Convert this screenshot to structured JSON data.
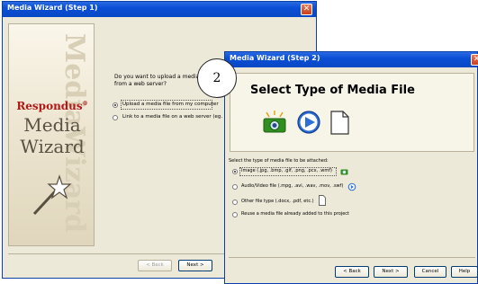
{
  "step1": {
    "title": "Media Wizard (Step 1)",
    "sidebar": {
      "watermark": "MediaWizard",
      "brand": "Respondus",
      "brand_mark": "®",
      "line1": "Media",
      "line2": "Wizard"
    },
    "question": "Do you want to upload a media file from a web server?",
    "options": [
      {
        "label": "Upload a media file from my computer",
        "selected": true
      },
      {
        "label": "Link to a media file on a web server (eg. Yo",
        "selected": false
      }
    ],
    "buttons": {
      "back": "< Back",
      "next": "Next >"
    }
  },
  "step2": {
    "title": "Media Wizard (Step 2)",
    "heading": "Select Type of Media File",
    "prompt": "Select the type of media file to be attached:",
    "options": [
      {
        "label": "Image (.jpg, .bmp, .gif, .png, .pcx, .wmf)",
        "selected": true,
        "icon": "camera-icon"
      },
      {
        "label": "Audio/Video file (.mpg, .avi, .wav, .mov, .swf)",
        "selected": false,
        "icon": "play-icon"
      },
      {
        "label": "Other file type (.docx, .pdf, etc.)",
        "selected": false,
        "icon": "document-icon"
      },
      {
        "label": "Reuse a media file already added to this project",
        "selected": false
      }
    ],
    "buttons": {
      "back": "< Back",
      "next": "Next >",
      "cancel": "Cancel",
      "help": "Help"
    }
  },
  "step_marker": "2",
  "colors": {
    "titlebar": "#0b4fd6",
    "brand_red": "#b01818",
    "dialog_bg": "#ece9d8"
  }
}
